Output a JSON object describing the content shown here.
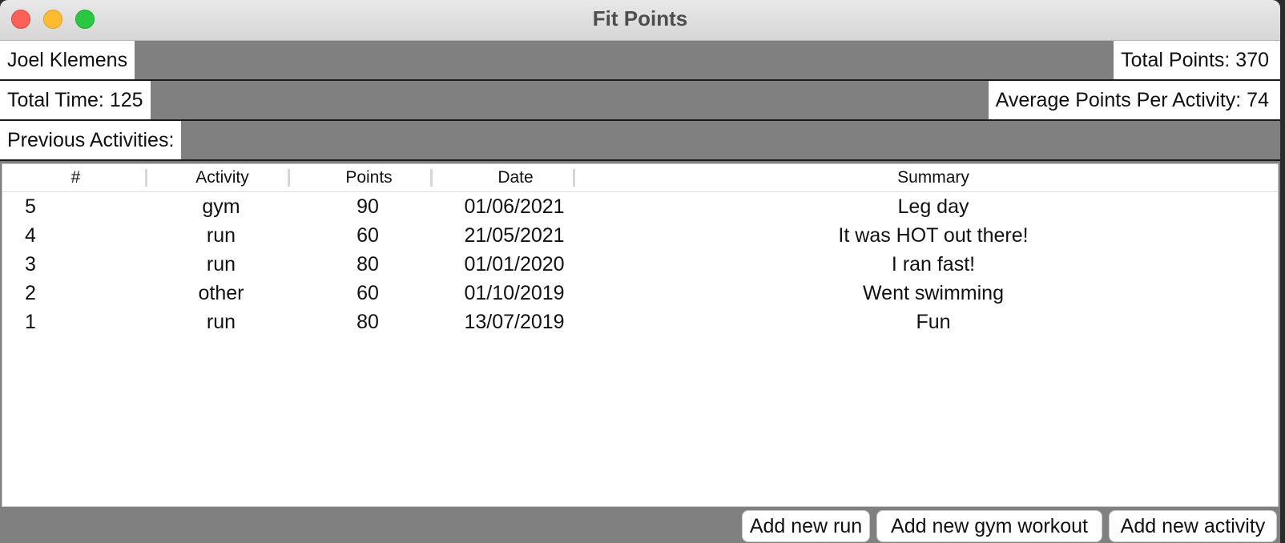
{
  "window": {
    "title": "Fit Points"
  },
  "summary": {
    "user_name": "Joel Klemens",
    "total_points": "Total Points: 370",
    "total_time": "Total Time: 125",
    "average_points": "Average Points Per Activity: 74",
    "previous_activities_label": "Previous Activities:"
  },
  "table": {
    "columns": [
      "#",
      "Activity",
      "Points",
      "Date",
      "Summary"
    ],
    "rows": [
      [
        "5",
        "gym",
        "90",
        "01/06/2021",
        "Leg day"
      ],
      [
        "4",
        "run",
        "60",
        "21/05/2021",
        "It was HOT out there!"
      ],
      [
        "3",
        "run",
        "80",
        "01/01/2020",
        "I ran fast!"
      ],
      [
        "2",
        "other",
        "60",
        "01/10/2019",
        "Went swimming"
      ],
      [
        "1",
        "run",
        "80",
        "13/07/2019",
        "Fun"
      ]
    ]
  },
  "buttons": {
    "add_run": "Add new run",
    "add_gym": "Add new gym workout",
    "add_activity": "Add new activity"
  }
}
